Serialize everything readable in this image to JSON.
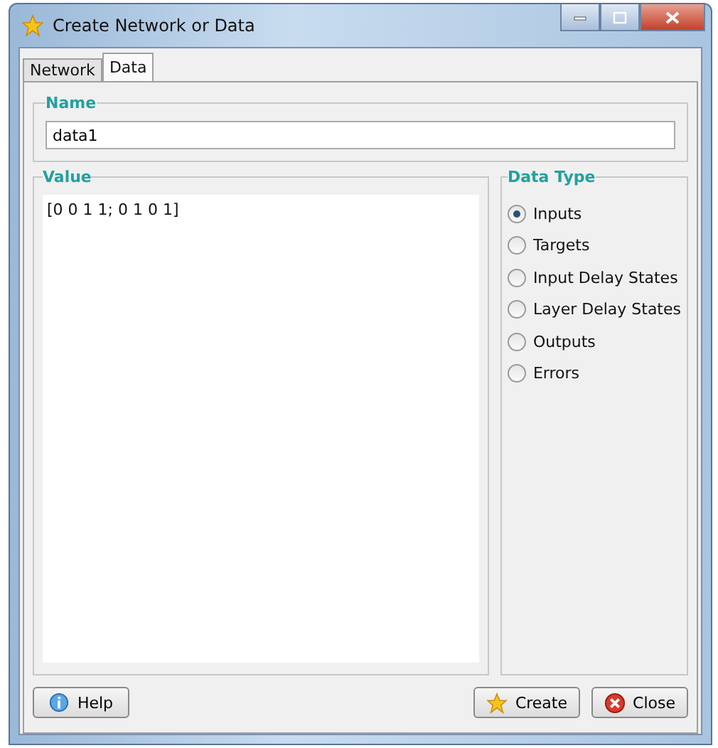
{
  "window": {
    "title": "Create Network or Data"
  },
  "tabs": [
    {
      "label": "Network",
      "selected": false
    },
    {
      "label": "Data",
      "selected": true
    }
  ],
  "name_group": {
    "title": "Name",
    "value": "data1"
  },
  "value_group": {
    "title": "Value",
    "value": "[0 0 1 1; 0 1 0 1]"
  },
  "data_type": {
    "title": "Data Type",
    "options": [
      {
        "label": "Inputs",
        "selected": true
      },
      {
        "label": "Targets",
        "selected": false
      },
      {
        "label": "Input Delay States",
        "selected": false
      },
      {
        "label": "Layer Delay States",
        "selected": false
      },
      {
        "label": "Outputs",
        "selected": false
      },
      {
        "label": "Errors",
        "selected": false
      }
    ]
  },
  "buttons": [
    {
      "kind": "help",
      "label": "Help"
    },
    {
      "kind": "create",
      "label": "Create"
    },
    {
      "kind": "close",
      "label": "Close"
    }
  ]
}
